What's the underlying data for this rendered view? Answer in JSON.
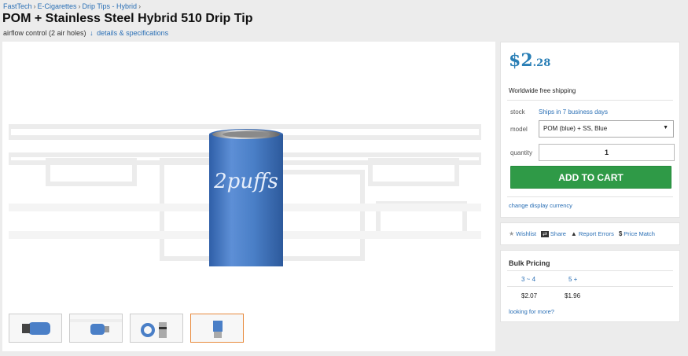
{
  "breadcrumb": {
    "items": [
      "FastTech",
      "E-Cigarettes",
      "Drip Tips - Hybrid"
    ],
    "separator": "›"
  },
  "product": {
    "title": "POM + Stainless Steel Hybrid 510 Drip Tip",
    "subtitle": "airflow control (2 air holes)",
    "details_arrow": "↓",
    "details_link": "details & specifications",
    "engraving": "2puffs",
    "body_color": "#4a7fc7"
  },
  "price": {
    "symbol": "$",
    "whole": "2",
    "cents": ".28",
    "shipping": "Worldwide free shipping"
  },
  "order": {
    "stock_label": "stock",
    "stock_value": "Ships in 7 business days",
    "model_label": "model",
    "model_value": "POM (blue) + SS, Blue",
    "quantity_label": "quantity",
    "quantity_value": "1",
    "add_to_cart": "ADD TO CART",
    "currency_link": "change display currency"
  },
  "actions": [
    {
      "icon": "star-icon",
      "label": "Wishlist"
    },
    {
      "icon": "share-icon",
      "label": "Share"
    },
    {
      "icon": "warning-icon",
      "label": "Report Errors"
    },
    {
      "icon": "dollar-icon",
      "label": "Price Match"
    }
  ],
  "bulk": {
    "title": "Bulk Pricing",
    "quantities": [
      "3 ~ 4",
      "5 +"
    ],
    "prices": [
      "$2.07",
      "$1.96"
    ],
    "more_link": "looking for more?"
  },
  "colors": {
    "accent": "#2a6fb5",
    "cart_button": "#2f9a47",
    "active_thumb_border": "#e88a3d"
  }
}
